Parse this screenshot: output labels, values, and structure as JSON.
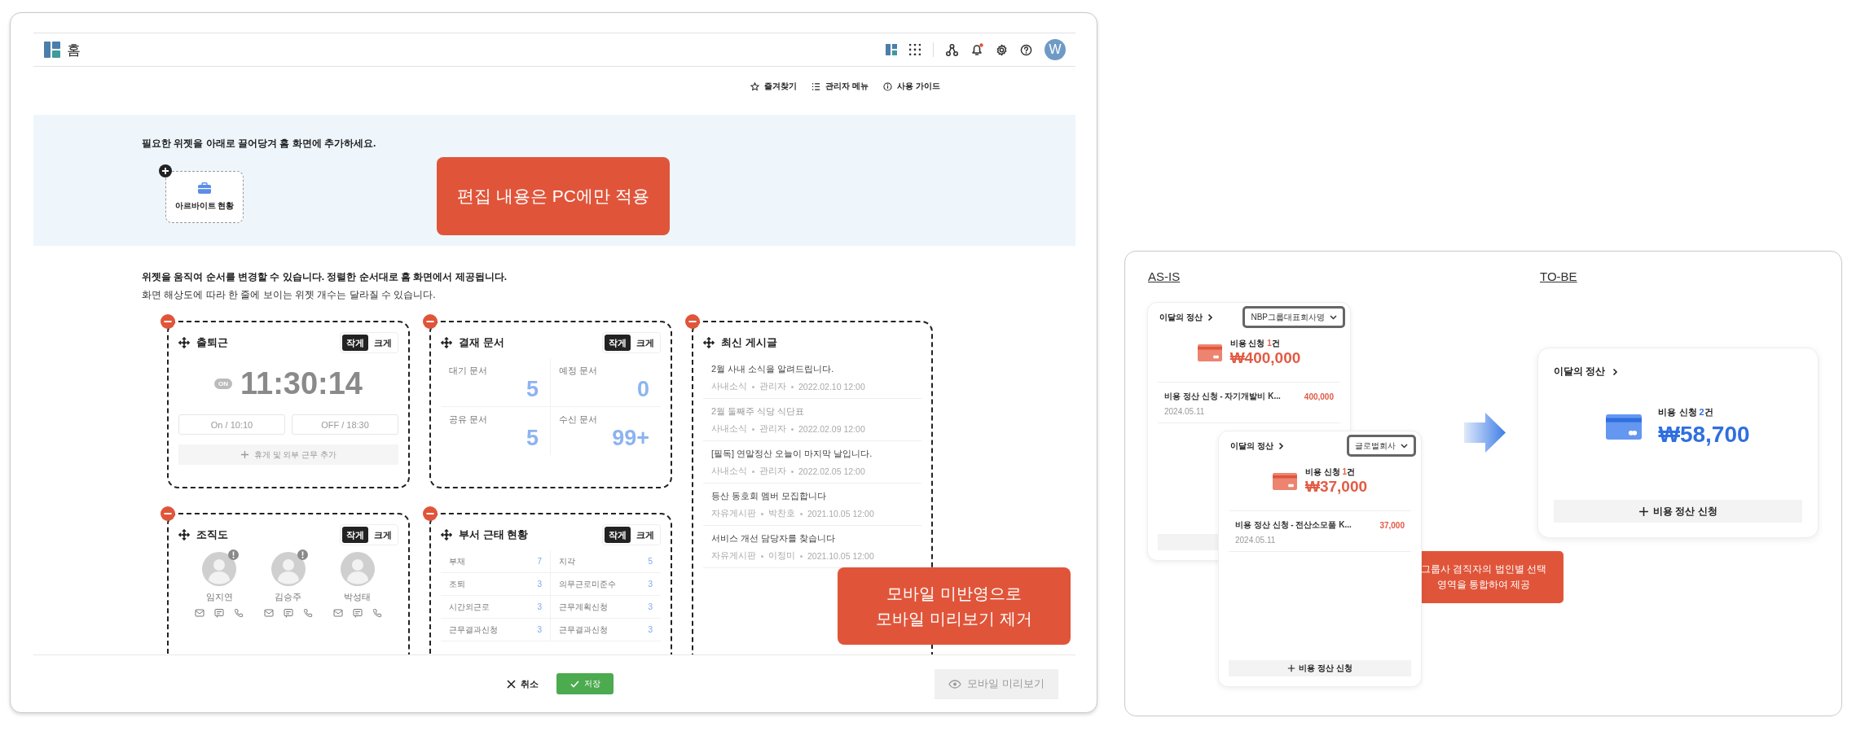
{
  "header": {
    "title": "홈",
    "avatar": "W",
    "has_notification": true
  },
  "toolbar_links": [
    {
      "label": "즐겨찾기"
    },
    {
      "label": "관리자 메뉴"
    },
    {
      "label": "사용 가이드"
    }
  ],
  "palette": {
    "hint": "필요한 위젯을 아래로 끌어당겨 홈 화면에 추가하세요.",
    "widgets": [
      {
        "label": "아르바이트 현황"
      }
    ],
    "callout": "편집 내용은 PC에만 적용"
  },
  "notes": {
    "title": "위젯을 움직여 순서를 변경할 수 있습니다. 정렬한 순서대로 홈 화면에서 제공됩니다.",
    "subtitle": "화면 해상도에 따라 한 줄에 보이는 위젯 개수는 달라질 수 있습니다."
  },
  "widgets": [
    {
      "kind": "attendance",
      "title": "출퇴근",
      "sizes": [
        {
          "label": "작게",
          "selected": true
        },
        {
          "label": "크게",
          "selected": false
        }
      ],
      "status": "ON",
      "time": "11:30:14",
      "clock_buttons": [
        {
          "label": "On / 10:10",
          "disabled": true
        },
        {
          "label": "OFF / 18:30",
          "disabled": true
        }
      ],
      "add_action": "휴게 및 외부 근무 추가"
    },
    {
      "kind": "approval",
      "title": "결재 문서",
      "sizes": [
        {
          "label": "작게",
          "selected": true
        },
        {
          "label": "크게",
          "selected": false
        }
      ],
      "stats": [
        {
          "label": "대기 문서",
          "value": "5"
        },
        {
          "label": "예정 문서",
          "value": "0"
        },
        {
          "label": "공유 문서",
          "value": "5"
        },
        {
          "label": "수신 문서",
          "value": "99+"
        }
      ]
    },
    {
      "kind": "posts",
      "title": "최신 게시글",
      "posts": [
        {
          "title": "2월 사내 소식을 알려드립니다.",
          "read": false,
          "board": "사내소식",
          "author": "관리자",
          "date": "2022.02.10 12:00"
        },
        {
          "title": "2월 둘째주 식당 식단표",
          "read": true,
          "board": "사내소식",
          "author": "관리자",
          "date": "2022.02.09 12:00"
        },
        {
          "title": "[필독] 연말정산 오늘이 마지막 날입니다.",
          "read": false,
          "board": "사내소식",
          "author": "관리자",
          "date": "2022.02.05 12:00"
        },
        {
          "title": "등산 동호회 멤버 모집합니다",
          "read": false,
          "board": "자유게시판",
          "author": "박찬호",
          "date": "2021.10.05 12:00"
        },
        {
          "title": "서비스 개선 담당자를 찾습니다",
          "read": false,
          "board": "자유게시판",
          "author": "이정미",
          "date": "2021.10.05 12:00"
        }
      ]
    },
    {
      "kind": "org",
      "title": "조직도",
      "sizes": [
        {
          "label": "작게",
          "selected": true
        },
        {
          "label": "크게",
          "selected": false
        }
      ],
      "members": [
        {
          "name": "임지연",
          "alert": true
        },
        {
          "name": "김승주",
          "alert": true
        },
        {
          "name": "박성태",
          "alert": false
        }
      ]
    },
    {
      "kind": "dept",
      "title": "부서 근태 현황",
      "sizes": [
        {
          "label": "작게",
          "selected": true
        },
        {
          "label": "크게",
          "selected": false
        }
      ],
      "stats": [
        {
          "label": "부재",
          "value": "7"
        },
        {
          "label": "지각",
          "value": "5"
        },
        {
          "label": "조퇴",
          "value": "3"
        },
        {
          "label": "의무근로미준수",
          "value": "3"
        },
        {
          "label": "시간외근로",
          "value": "3"
        },
        {
          "label": "근무계획신청",
          "value": "3"
        },
        {
          "label": "근무결과신청",
          "value": "3"
        },
        {
          "label": "근무결과신청",
          "value": "3"
        }
      ]
    }
  ],
  "mobile_callout": "모바일 미반영으로\n모바일 미리보기 제거",
  "footer": {
    "cancel": "취소",
    "save": "저장",
    "preview": {
      "label": "모바일 미리보기",
      "disabled": true
    }
  },
  "comparison": {
    "before": {
      "label": "AS-IS",
      "cards": [
        {
          "title": "이달의 정산",
          "company": "NBP그룹대표회사명",
          "count_label": "비용 신청",
          "count": "1",
          "count_unit": "건",
          "amount": "₩400,000",
          "items": [
            {
              "title": "비용 정산 신청 - 자기개발비 K...",
              "amount": "400,000",
              "date": "2024.05.11"
            }
          ]
        },
        {
          "title": "이달의 정산",
          "company": "글로벌회사",
          "count_label": "비용 신청",
          "count": "1",
          "count_unit": "건",
          "amount": "₩37,000",
          "items": [
            {
              "title": "비용 정산 신청 - 전산소모품 K...",
              "amount": "37,000",
              "date": "2024.05.11"
            }
          ],
          "apply": "비용 정산 신청"
        }
      ]
    },
    "after": {
      "label": "TO-BE",
      "card": {
        "title": "이달의 정산",
        "count_label": "비용 신청",
        "count": "2",
        "count_unit": "건",
        "amount": "₩58,700",
        "apply": "비용 정산 신청"
      }
    },
    "callout": "그룹사 겸직자의 법인별 선택\n영역을 통합하여 제공"
  }
}
